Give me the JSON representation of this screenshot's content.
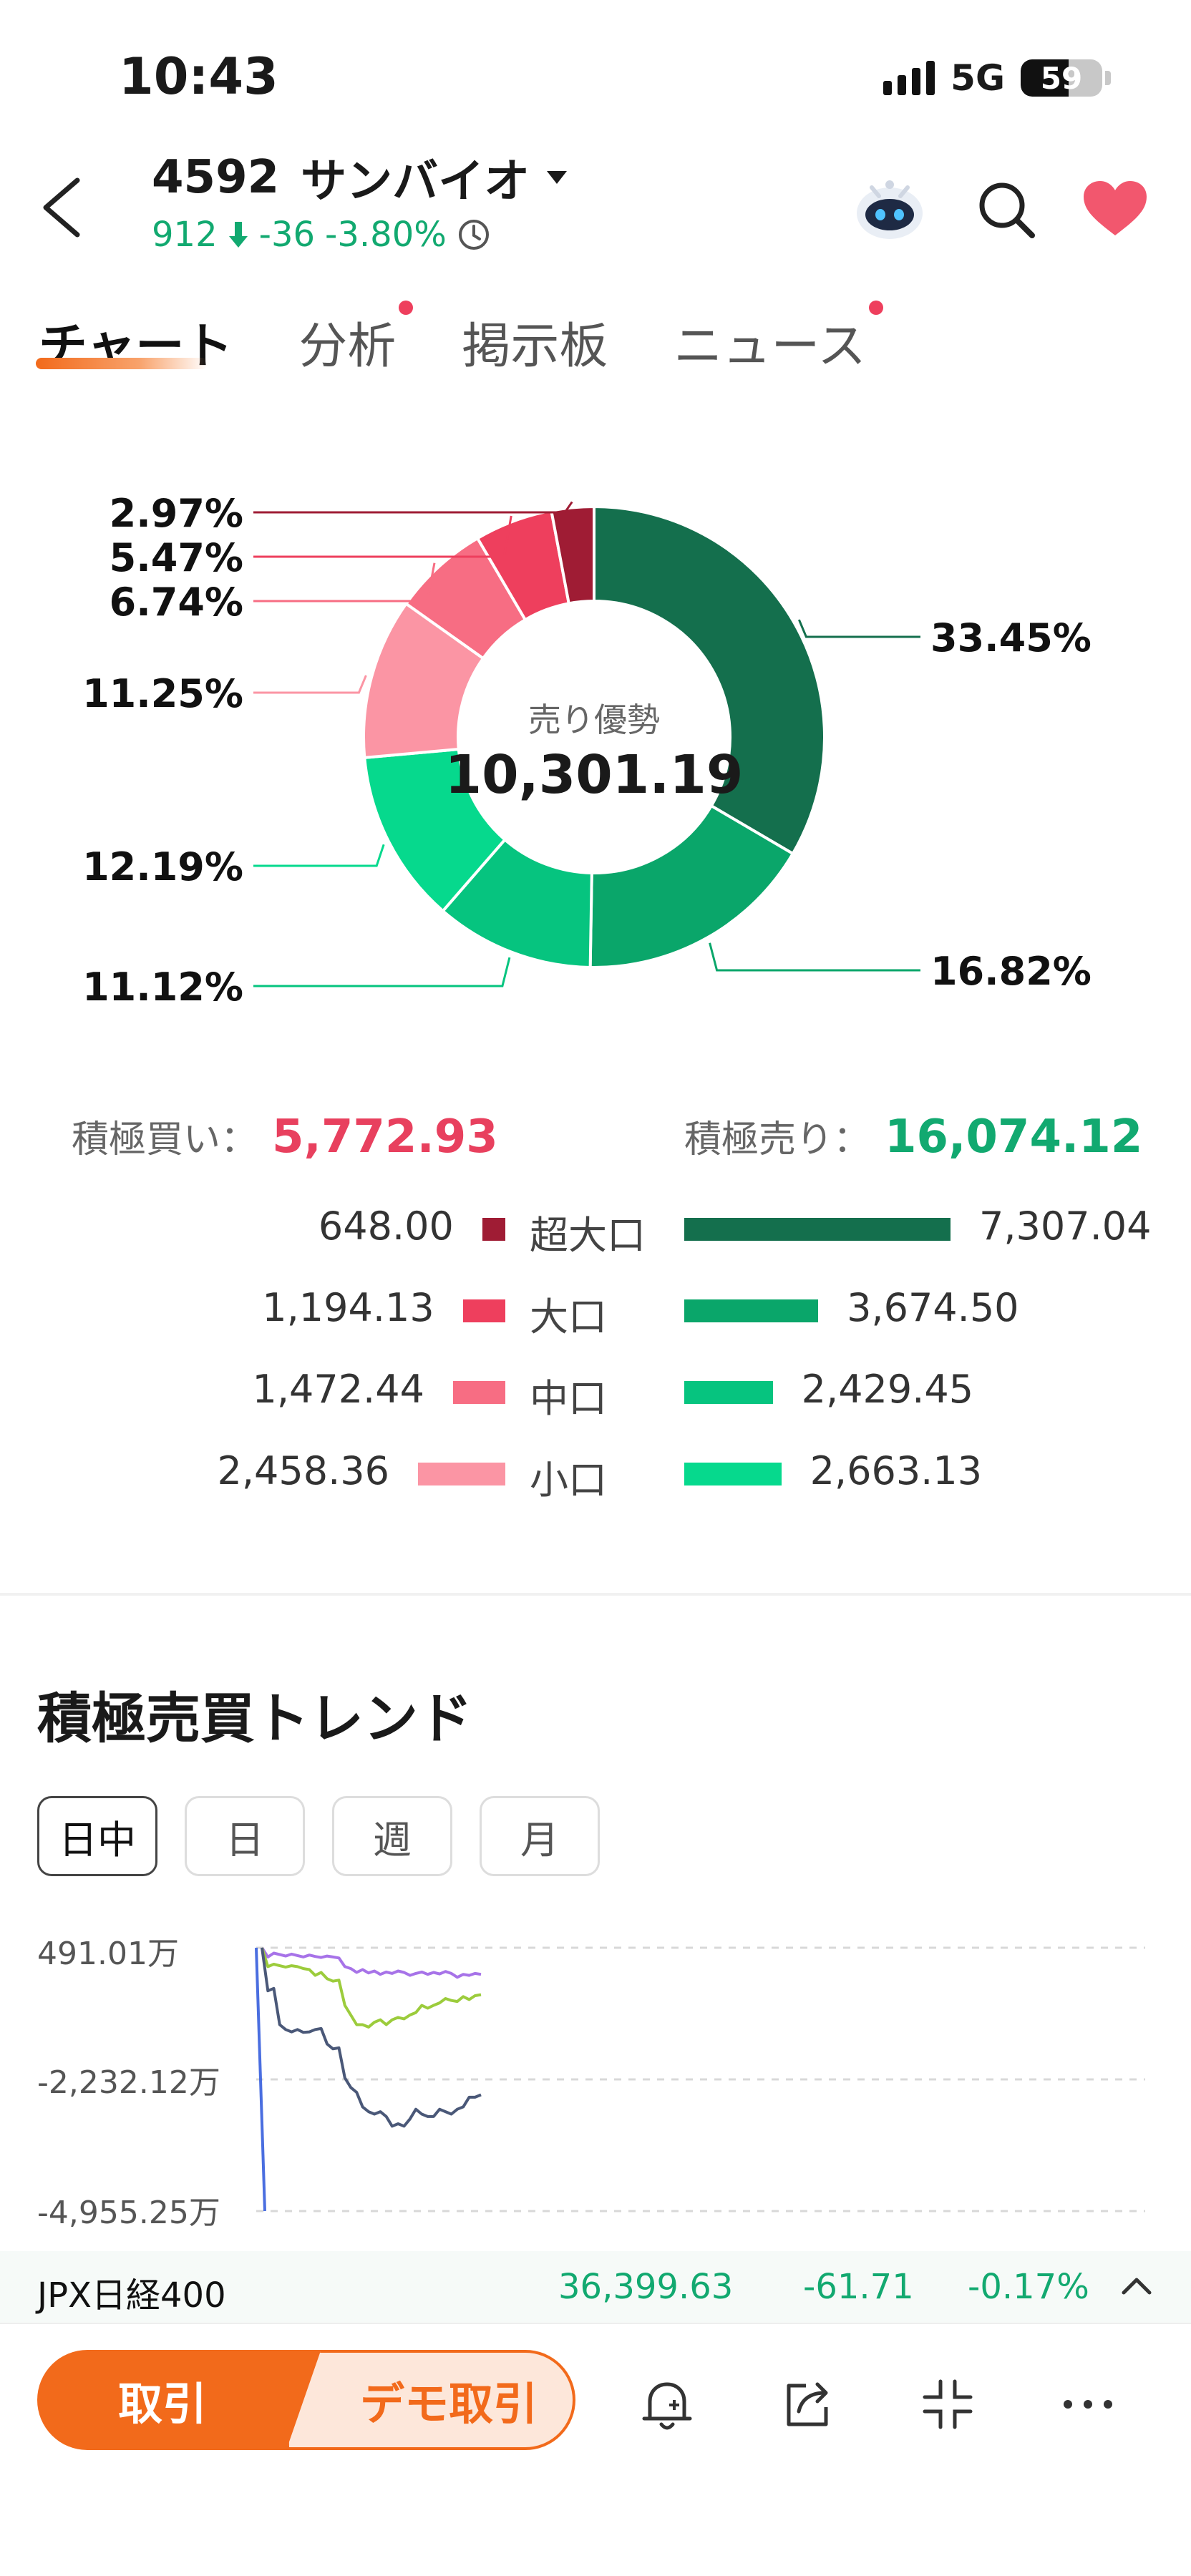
{
  "status_bar": {
    "time": "10:43",
    "network": "5G",
    "battery": "59",
    "battery_level": 0.59
  },
  "header": {
    "code": "4592",
    "name": "サンバイオ",
    "price": "912",
    "change": "-36",
    "change_pct": "-3.80%"
  },
  "tabs": [
    {
      "label": "チャート",
      "active": true,
      "dot": false
    },
    {
      "label": "分析",
      "active": false,
      "dot": true
    },
    {
      "label": "掲示板",
      "active": false,
      "dot": false
    },
    {
      "label": "ニュース",
      "active": false,
      "dot": true
    }
  ],
  "donut": {
    "center_label": "売り優勢",
    "center_value": "10,301.19",
    "slices": [
      {
        "label": "33.45%",
        "value": 33.45,
        "color": "#146f4d"
      },
      {
        "label": "16.82%",
        "value": 16.82,
        "color": "#0aa66a"
      },
      {
        "label": "11.12%",
        "value": 11.12,
        "color": "#06c47f"
      },
      {
        "label": "12.19%",
        "value": 12.19,
        "color": "#06d98d"
      },
      {
        "label": "11.25%",
        "value": 11.25,
        "color": "#fb95a4"
      },
      {
        "label": "6.74%",
        "value": 6.74,
        "color": "#f76d83"
      },
      {
        "label": "5.47%",
        "value": 5.47,
        "color": "#ee3f5d"
      },
      {
        "label": "2.97%",
        "value": 2.97,
        "color": "#9f1c34"
      }
    ]
  },
  "aggressive": {
    "buy_label": "積極買い：",
    "buy_value": "5,772.93",
    "sell_label": "積極売り：",
    "sell_value": "16,074.12"
  },
  "flows": [
    {
      "label": "超大口",
      "buy": "648.00",
      "buy_num": 648.0,
      "sell": "7,307.04",
      "sell_num": 7307.04,
      "buy_color": "#9f1c34",
      "sell_color": "#146f4d"
    },
    {
      "label": "大口",
      "buy": "1,194.13",
      "buy_num": 1194.13,
      "sell": "3,674.50",
      "sell_num": 3674.5,
      "buy_color": "#ee3f5d",
      "sell_color": "#0aa66a"
    },
    {
      "label": "中口",
      "buy": "1,472.44",
      "buy_num": 1472.44,
      "sell": "2,429.45",
      "sell_num": 2429.45,
      "buy_color": "#f76d83",
      "sell_color": "#06c47f"
    },
    {
      "label": "小口",
      "buy": "2,458.36",
      "buy_num": 2458.36,
      "sell": "2,663.13",
      "sell_num": 2663.13,
      "buy_color": "#fb95a4",
      "sell_color": "#06d98d"
    }
  ],
  "trend": {
    "title": "積極売買トレンド",
    "periods": [
      "日中",
      "日",
      "週",
      "月"
    ],
    "active_period": "日中",
    "y_labels": [
      "491.01万",
      "-2,232.12万",
      "-4,955.25万"
    ]
  },
  "chart_data": {
    "type": "line",
    "ylim": [
      -4955.25,
      491.01
    ],
    "yticks": [
      491.01,
      -2232.12,
      -4955.25
    ],
    "series": [
      {
        "color": "#a773e8",
        "values": [
          491,
          300,
          380,
          350,
          320,
          360,
          330,
          300,
          340,
          310,
          290,
          320,
          300,
          280,
          100,
          60,
          -20,
          40,
          -30,
          10,
          -60,
          -10,
          -40,
          10,
          -20,
          -80,
          -40,
          -10,
          -60,
          -20,
          -50,
          0,
          -40,
          -120,
          -60,
          -80,
          -40,
          -60
        ]
      },
      {
        "color": "#9ccc3c",
        "values": [
          491,
          100,
          150,
          120,
          90,
          120,
          100,
          60,
          40,
          -80,
          -20,
          -150,
          -200,
          -180,
          -700,
          -900,
          -1100,
          -1100,
          -1150,
          -1050,
          -1000,
          -1100,
          -1000,
          -950,
          -980,
          -900,
          -850,
          -700,
          -760,
          -700,
          -650,
          -560,
          -600,
          -620,
          -520,
          -580,
          -500,
          -480
        ]
      },
      {
        "color": "#4a5878",
        "values": [
          491,
          -400,
          -350,
          -1100,
          -1200,
          -1250,
          -1200,
          -1260,
          -1250,
          -1200,
          -1180,
          -1500,
          -1600,
          -1580,
          -2200,
          -2400,
          -2500,
          -2800,
          -2900,
          -2950,
          -2900,
          -3000,
          -3200,
          -3150,
          -3200,
          -3050,
          -2850,
          -2950,
          -3000,
          -3000,
          -2850,
          -2900,
          -2950,
          -2850,
          -2800,
          -2600,
          -2600,
          -2550
        ]
      },
      {
        "color": "#4a6ee0",
        "values": [
          491,
          -4955.25
        ]
      }
    ]
  },
  "ticker": {
    "name": "JPX日経400",
    "price": "36,399.63",
    "change": "-61.71",
    "change_pct": "-0.17%"
  },
  "bottom_bar": {
    "trade_label": "取引",
    "demo_label": "デモ取引"
  },
  "icons": {
    "back": "back-arrow-icon",
    "robot": "robot-assistant-icon",
    "search": "search-icon",
    "favorite": "heart-icon",
    "alert": "bell-add-icon",
    "share": "share-icon",
    "collapse": "collapse-icon",
    "more": "more-icon"
  }
}
